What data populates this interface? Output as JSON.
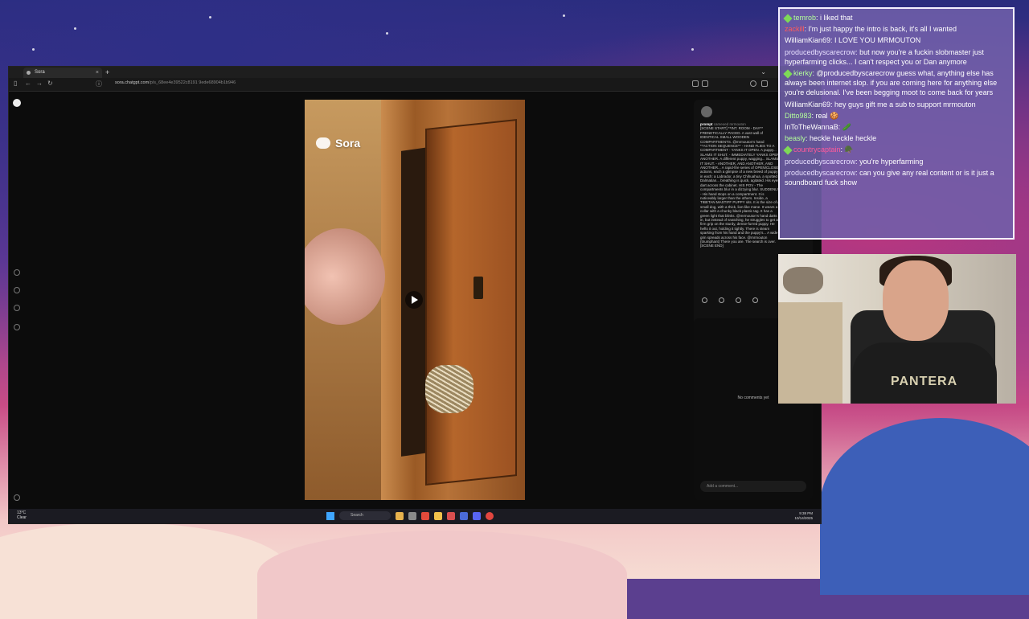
{
  "browser": {
    "tab_title": "Sora",
    "new_tab": "+",
    "url_domain": "sora.chatgpt.com",
    "url_path": "/p/s_68ee4e39522c8191 9ede68904b1b946"
  },
  "video": {
    "brand": "Sora"
  },
  "panel": {
    "author": "prompt",
    "cameo": "cameoed mrmouton",
    "description": "[SCENE START] **INT. ROOM - DAY** FRENETICALLY PACED. A vast wall of IDENTICAL SMALL WOODEN COMPARTMENTS. @mrmouton's hand **ACTION SEQUENCE** - HAND FLIES TO A COMPARTMENT - YANKS IT OPEN. A puppy... SLAMS IT SHUT. - IMMEDIATELY YANKS OPEN ANOTHER. A different puppy, wagging... SLAMS IT SHUT. - ANOTHER, AND ANOTHER, AND ANOTHER... A rapid-fire series of OPEN/CLOSE actions, each a glimpse of a new breed of puppy in each: a Labrador, a tiny Chihuahua, a spotted Dalmatian... breathing is quick, agitated. His eyes dart across the cabinet. HIS POV - The compartments blur in a dizzying blur. SUDDENLY - His hand stops on a compartment. It is noticeably larger than the others. Inside, a TIBETAN MASTIFF PUPPY sits. It is the size of a small dog, with a thick, lion-like mane. It wears a collar with a chunky black plastic tag. It has a green light that blinks. @mrmouton's hand darts in, but instead of snatching, he struggles to get a firm grip on the sturdy, dense-furred puppy. He hefts it out, holding it tightly. There is steam sparking from his hand and the puppy's... A wide grin spreads across his face. @mrmouton (triumphant) There you are. The search is over. [SCENE END]",
    "no_comments": "No comments yet",
    "add_comment": "Add a comment..."
  },
  "taskbar": {
    "weather_temp": "13°C",
    "weather_desc": "Clear",
    "search": "Search",
    "time": "9:38 PM",
    "date": "10/14/2025"
  },
  "chat": {
    "messages": [
      {
        "user": "temrob",
        "color": "#b3ff9a",
        "badge": true,
        "text": "i liked that"
      },
      {
        "user": "zackill",
        "color": "#ff5a5a",
        "badge": false,
        "text": "I'm just happy the intro is back, it's all I wanted"
      },
      {
        "user": "WilliamKian69",
        "color": "#ffffff",
        "badge": false,
        "text": "I LOVE YOU MRMOUTON"
      },
      {
        "user": "producedbyscarecrow",
        "color": "#e8e0ff",
        "badge": false,
        "text": "but now you're a fuckin slobmaster just hyperfarming clicks... I can't respect you or Dan anymore"
      },
      {
        "user": "kierky",
        "color": "#b3ff9a",
        "badge": true,
        "text": "@producedbyscarecrow guess what, anything else has always been internet slop. if you are coming here for anything else you're delusional. I've been begging moot to come back for years"
      },
      {
        "user": "WilliamKian69",
        "color": "#ffffff",
        "badge": false,
        "text": "hey guys gift me a sub to support mrmouton"
      },
      {
        "user": "Ditto983",
        "color": "#b3ff9a",
        "badge": false,
        "text": "real 🍪"
      },
      {
        "user": "InToTheWannaB",
        "color": "#ffffff",
        "badge": false,
        "text": "🥒"
      },
      {
        "user": "beasly",
        "color": "#b3ff9a",
        "badge": false,
        "text": "heckle heckle heckle"
      },
      {
        "user": "countrycaptain",
        "color": "#ff5a9a",
        "badge": true,
        "text": "🪖"
      },
      {
        "user": "producedbyscarecrow",
        "color": "#e8e0ff",
        "badge": false,
        "text": "you're hyperfarming"
      },
      {
        "user": "producedbyscarecrow",
        "color": "#e8e0ff",
        "badge": false,
        "text": "can you give any real content or is it just a soundboard fuck show"
      }
    ]
  },
  "webcam": {
    "shirt_text": "PANTERA"
  }
}
